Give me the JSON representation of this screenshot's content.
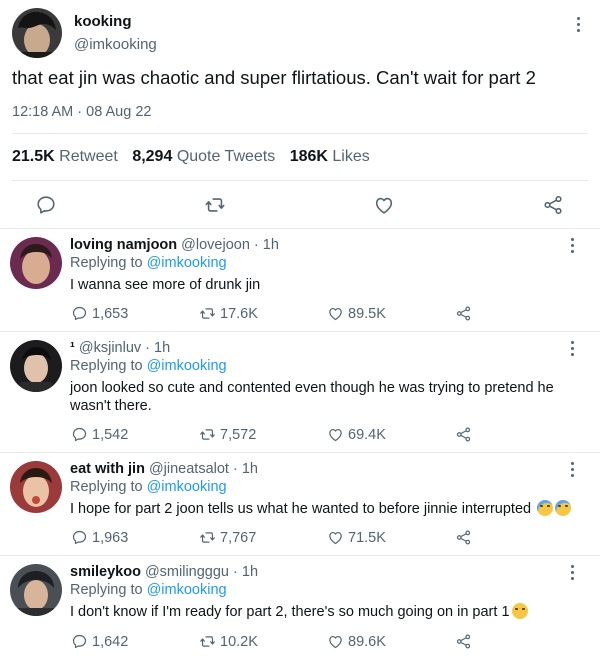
{
  "tweet": {
    "display_name": "kooking",
    "handle": "@imkooking",
    "text": "that eat jin was chaotic and super flirtatious. Can't wait for part 2",
    "timestamp": "12:18 AM · 08 Aug 22",
    "stats": {
      "retweets_count": "21.5K",
      "retweets_label": "Retweet",
      "quotes_count": "8,294",
      "quotes_label": "Quote Tweets",
      "likes_count": "186K",
      "likes_label": "Likes"
    }
  },
  "replies": [
    {
      "display_name": "loving namjoon",
      "handle": "@lovejoon",
      "time": "1h",
      "replying_prefix": "Replying to",
      "replying_to": "@imkooking",
      "text": "I wanna see more of drunk jin",
      "comments": "1,653",
      "retweets": "17.6K",
      "likes": "89.5K"
    },
    {
      "display_name": "¹",
      "handle": "@ksjinluv",
      "time": "1h",
      "replying_prefix": "Replying to",
      "replying_to": "@imkooking",
      "text": "joon looked so cute and contented even though he was trying to pretend he wasn't there.",
      "comments": "1,542",
      "retweets": "7,572",
      "likes": "69.4K"
    },
    {
      "display_name": "eat with jin",
      "handle": "@jineatsalot",
      "time": "1h",
      "replying_prefix": "Replying to",
      "replying_to": "@imkooking",
      "text": "I hope for part 2 joon tells us what he wanted to before jinnie interrupted",
      "comments": "1,963",
      "retweets": "7,767",
      "likes": "71.5K"
    },
    {
      "display_name": "smileykoo",
      "handle": "@smilingggu",
      "time": "1h",
      "replying_prefix": "Replying to",
      "replying_to": "@imkooking",
      "text": "I don't know if I'm ready for part 2, there's so much going on in part 1",
      "comments": "1,642",
      "retweets": "10.2K",
      "likes": "89.6K"
    }
  ],
  "colors": {
    "link": "#1d9bf0",
    "secondary_text": "#536471",
    "primary_text": "#0f1419",
    "divider": "#e4e8eb"
  },
  "icons": [
    "more-icon",
    "reply-icon",
    "retweet-icon",
    "like-icon",
    "share-icon"
  ]
}
